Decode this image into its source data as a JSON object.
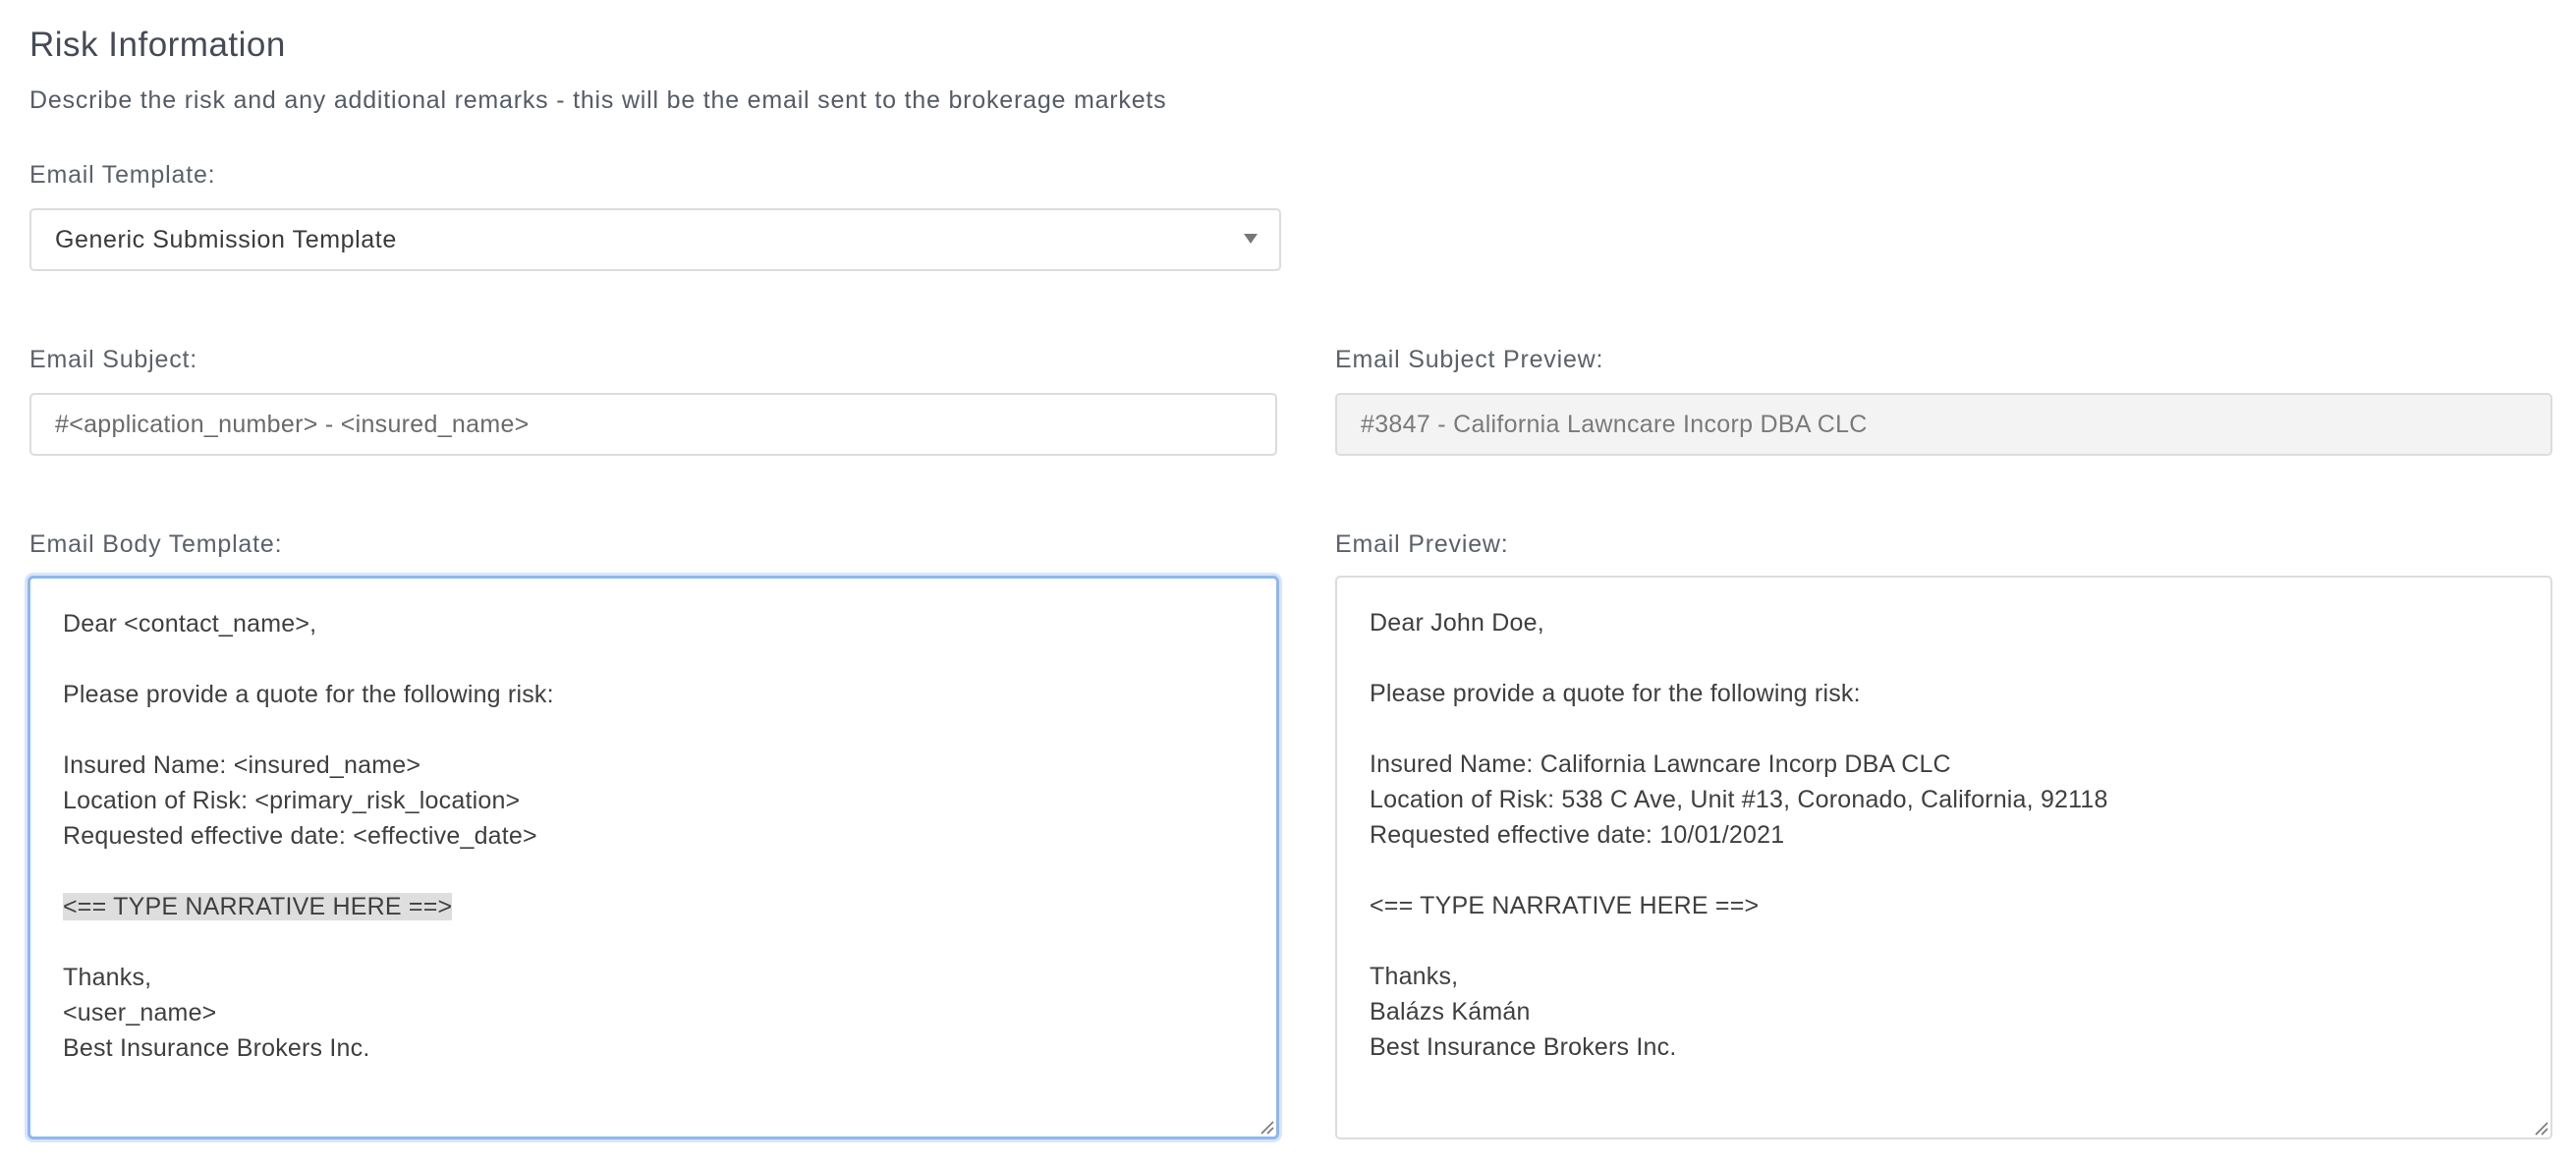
{
  "section": {
    "title": "Risk Information",
    "subtitle": "Describe the risk and any additional remarks - this will be the email sent to the brokerage markets"
  },
  "template": {
    "label": "Email Template:",
    "selected": "Generic Submission Template"
  },
  "subject": {
    "label": "Email Subject:",
    "value": "#<application_number> - <insured_name>"
  },
  "subject_preview": {
    "label": "Email Subject Preview:",
    "value": "#3847 - California Lawncare Incorp DBA CLC"
  },
  "body_template": {
    "label": "Email Body Template:",
    "lines": [
      "Dear <contact_name>,",
      "",
      "Please provide a quote for the following risk:",
      "",
      "Insured Name: <insured_name>",
      "Location of Risk: <primary_risk_location>",
      "Requested effective date: <effective_date>",
      "",
      "<== TYPE NARRATIVE HERE ==>",
      "",
      "Thanks,",
      "<user_name>",
      "Best Insurance Brokers Inc."
    ]
  },
  "body_preview": {
    "label": "Email Preview:",
    "lines": [
      "Dear John Doe,",
      "",
      "Please provide a quote for the following risk:",
      "",
      "Insured Name: California Lawncare Incorp DBA CLC",
      "Location of Risk: 538 C Ave, Unit #13, Coronado, California, 92118",
      "Requested effective date: 10/01/2021",
      "",
      "<== TYPE NARRATIVE HERE ==>",
      "",
      "Thanks,",
      "Balázs Kámán",
      "Best Insurance Brokers Inc."
    ]
  },
  "icons": {
    "select_caret": "caret-down-icon",
    "resize": "resize-grip-icon"
  },
  "colors": {
    "focus_border": "#8fb7ef",
    "readonly_bg": "#f3f3f3",
    "highlight": "#dedede"
  }
}
